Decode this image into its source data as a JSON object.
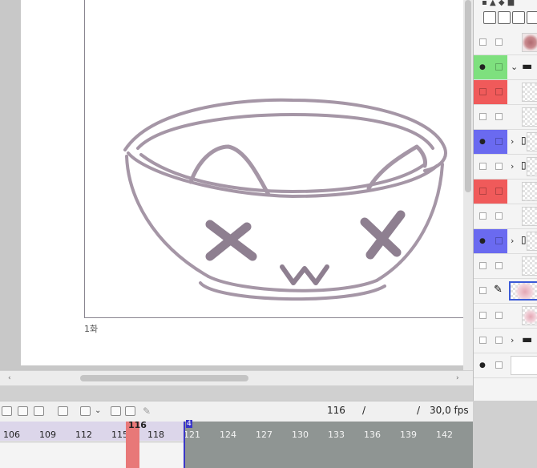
{
  "canvas": {
    "frame_label": "1화"
  },
  "timeline": {
    "current_frame": "116",
    "playhead_label": "116",
    "end_marker": "4",
    "slash": "/",
    "fps": "30,0 fps",
    "ticks": [
      "106",
      "109",
      "112",
      "115",
      "118",
      "121",
      "124",
      "127",
      "130",
      "133",
      "136",
      "139",
      "142"
    ]
  },
  "layers": {
    "rows": [
      {
        "vis": "plain",
        "lock": "plain",
        "thumb": "stain",
        "chev": ""
      },
      {
        "vis": "green-eye",
        "lock": "green",
        "thumb": "folder-open",
        "chev": "⌄"
      },
      {
        "vis": "red",
        "lock": "red",
        "thumb": "checker",
        "chev": ""
      },
      {
        "vis": "plain",
        "lock": "plain",
        "thumb": "checker",
        "chev": ""
      },
      {
        "vis": "blue-eye",
        "lock": "blue",
        "thumb": "stack",
        "chev": "›"
      },
      {
        "vis": "plain",
        "lock": "plain",
        "thumb": "stack",
        "chev": "›"
      },
      {
        "vis": "red",
        "lock": "red",
        "thumb": "checker",
        "chev": ""
      },
      {
        "vis": "plain",
        "lock": "plain",
        "thumb": "checker",
        "chev": ""
      },
      {
        "vis": "blue-eye",
        "lock": "blue",
        "thumb": "stack",
        "chev": "›"
      },
      {
        "vis": "plain",
        "lock": "plain",
        "thumb": "checker",
        "chev": ""
      },
      {
        "vis": "plain",
        "lock": "pen",
        "thumb": "pink-selected",
        "chev": ""
      },
      {
        "vis": "plain",
        "lock": "plain",
        "thumb": "pink",
        "chev": ""
      },
      {
        "vis": "plain",
        "lock": "plain",
        "thumb": "folder",
        "chev": "›"
      },
      {
        "vis": "eye",
        "lock": "plain",
        "thumb": "white",
        "chev": ""
      }
    ],
    "colors": {
      "green": "#7ee07e",
      "red": "#f05a5a",
      "blue": "#6a6af0"
    }
  }
}
